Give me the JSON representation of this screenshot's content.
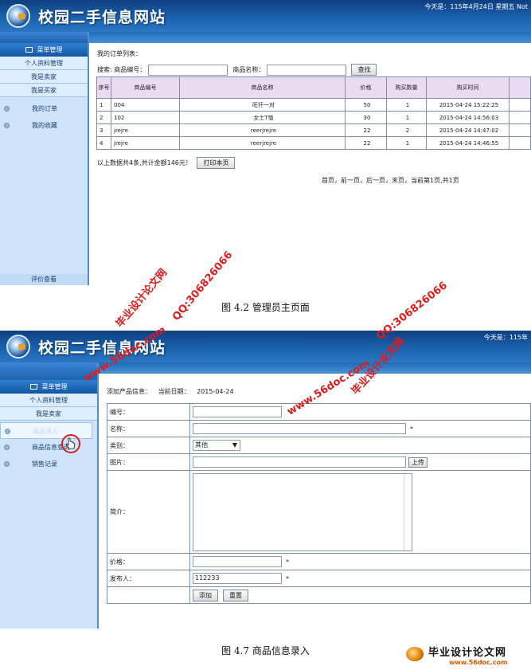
{
  "site": {
    "title": "校园二手信息网站"
  },
  "screen1": {
    "date": "今天是：115年4月24日 星期五 Not",
    "menu_title": "菜单管理",
    "side_links": [
      "个人资料管理",
      "我是卖家",
      "我是买家"
    ],
    "side_subs": [
      "我的订单",
      "我的收藏"
    ],
    "side_foot": "评价查看",
    "list_title": "我的订单列表：",
    "search_label": "搜索: 商品编号：",
    "name_label": "商品名称：",
    "search_button": "查找",
    "headers": [
      "序号",
      "商品编号",
      "商品名称",
      "价格",
      "购买数量",
      "购买时间"
    ],
    "rows": [
      [
        "1",
        "004",
        "旺扦一对",
        "50",
        "1",
        "2015-04-24 15:22:25"
      ],
      [
        "2",
        "102",
        "女士T恤",
        "30",
        "1",
        "2015-04-24 14:56:03"
      ],
      [
        "3",
        "jrejre",
        "reerjrejre",
        "22",
        "2",
        "2015-04-24 14:47:02"
      ],
      [
        "4",
        "jrejre",
        "reerjrejre",
        "22",
        "1",
        "2015-04-24 14:46:55"
      ]
    ],
    "summary": "以上数据共4条,共计金额146元！",
    "print_button": "打印本页",
    "pager": "首页，前一页，后一页，末页，当前第1页,共1页"
  },
  "caption1": "图 4.2 管理员主页面",
  "screen2": {
    "date": "今天是：115年",
    "menu_title": "菜单管理",
    "side_links": [
      "个人资料管理",
      "我是卖家"
    ],
    "side_subs": [
      "商品录入",
      "商品信息查询",
      "销售记录"
    ],
    "form_title": "添加产品信息：",
    "form_date_label": "当前日期：",
    "form_date": "2015-04-24",
    "labels": {
      "code": "编号：",
      "name": "名称：",
      "category": "类别：",
      "image": "图片：",
      "intro": "简介：",
      "price": "价格：",
      "publisher": "发布人："
    },
    "category_value": "其他",
    "upload_button": "上传",
    "publisher_value": "112233",
    "required_mark": "*",
    "add_button": "添加",
    "reset_button": "重置"
  },
  "caption2": "图 4.7 商品信息录入",
  "watermarks": {
    "cn": "毕业设计论文网",
    "url": "www.56doc.com",
    "qq": "QQ:306826066",
    "footer_cn": "毕业设计论文网",
    "footer_url": "www.56doc.com"
  },
  "colors": {
    "header_dark": "#0d3f80",
    "header_light": "#2a77c4",
    "sidebar": "#cfe4fa",
    "table_head": "#e9dcf2",
    "watermark": "#e01c1c"
  }
}
